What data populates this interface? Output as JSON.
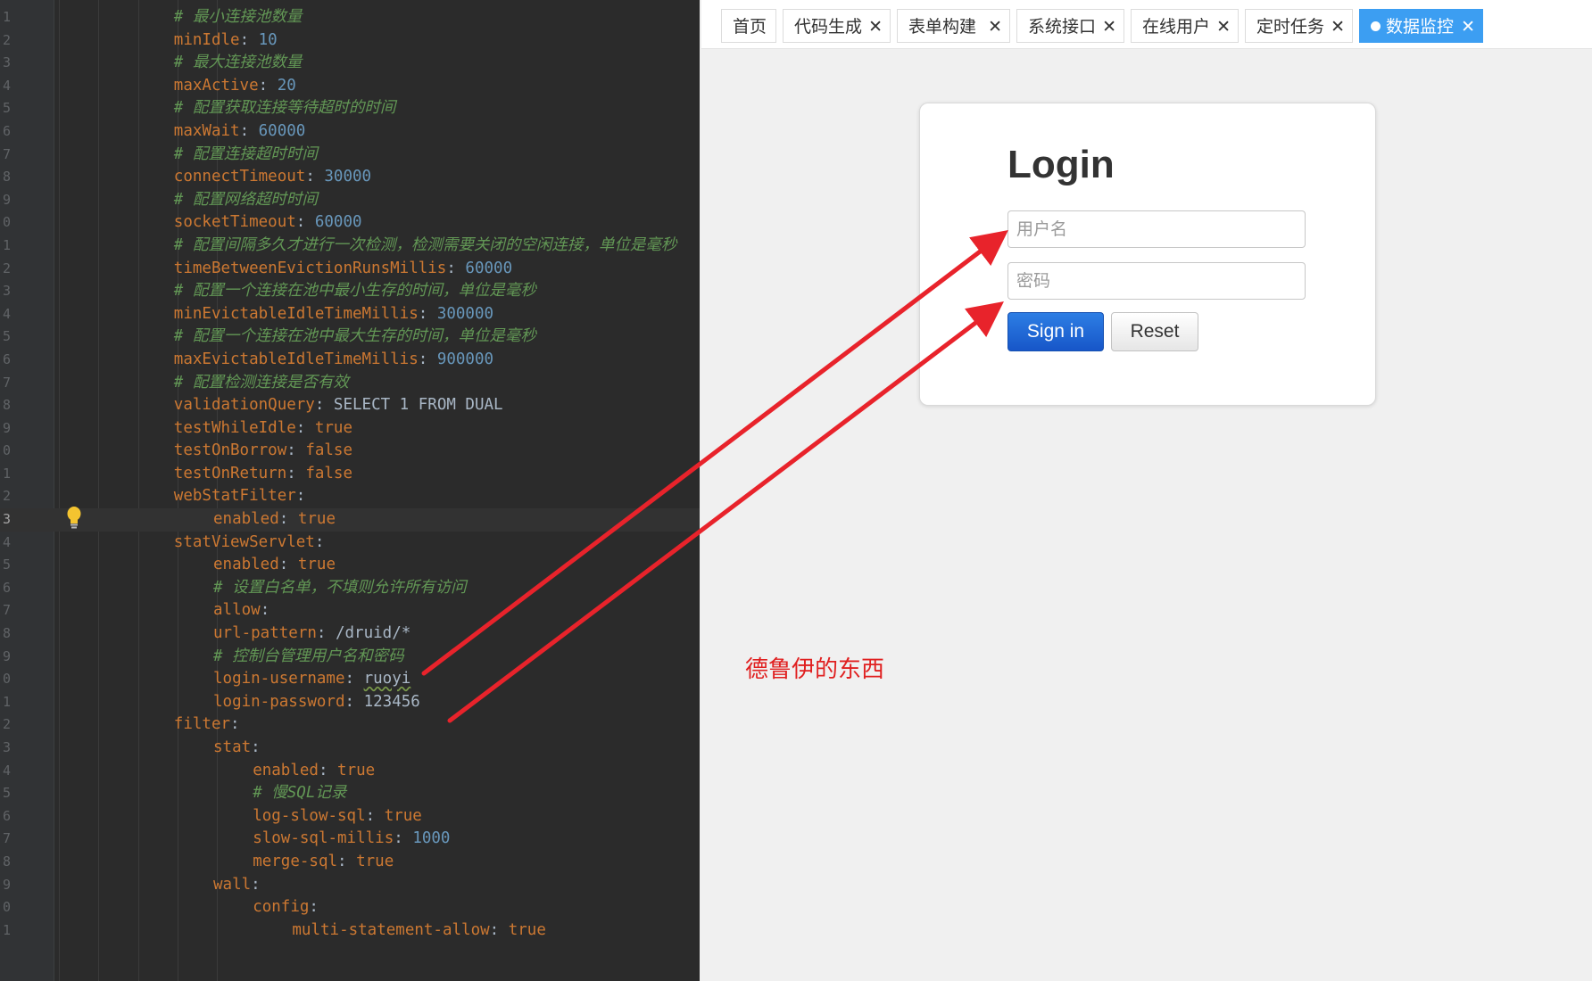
{
  "editor": {
    "lines": [
      {
        "num": "1",
        "indent": 4,
        "tokens": [
          {
            "t": "# 最小连接池数量",
            "c": "c"
          }
        ]
      },
      {
        "num": "2",
        "indent": 4,
        "tokens": [
          {
            "t": "minIdle",
            "c": "k"
          },
          {
            "t": ": ",
            "c": "p"
          },
          {
            "t": "10",
            "c": "n"
          }
        ]
      },
      {
        "num": "3",
        "indent": 4,
        "tokens": [
          {
            "t": "# 最大连接池数量",
            "c": "c"
          }
        ]
      },
      {
        "num": "4",
        "indent": 4,
        "tokens": [
          {
            "t": "maxActive",
            "c": "k"
          },
          {
            "t": ": ",
            "c": "p"
          },
          {
            "t": "20",
            "c": "n"
          }
        ]
      },
      {
        "num": "5",
        "indent": 4,
        "tokens": [
          {
            "t": "# 配置获取连接等待超时的时间",
            "c": "c"
          }
        ]
      },
      {
        "num": "6",
        "indent": 4,
        "tokens": [
          {
            "t": "maxWait",
            "c": "k"
          },
          {
            "t": ": ",
            "c": "p"
          },
          {
            "t": "60000",
            "c": "n"
          }
        ]
      },
      {
        "num": "7",
        "indent": 4,
        "tokens": [
          {
            "t": "# 配置连接超时时间",
            "c": "c"
          }
        ]
      },
      {
        "num": "8",
        "indent": 4,
        "tokens": [
          {
            "t": "connectTimeout",
            "c": "k"
          },
          {
            "t": ": ",
            "c": "p"
          },
          {
            "t": "30000",
            "c": "n"
          }
        ]
      },
      {
        "num": "9",
        "indent": 4,
        "tokens": [
          {
            "t": "# 配置网络超时时间",
            "c": "c"
          }
        ]
      },
      {
        "num": "0",
        "indent": 4,
        "tokens": [
          {
            "t": "socketTimeout",
            "c": "k"
          },
          {
            "t": ": ",
            "c": "p"
          },
          {
            "t": "60000",
            "c": "n"
          }
        ]
      },
      {
        "num": "1",
        "indent": 4,
        "tokens": [
          {
            "t": "# 配置间隔多久才进行一次检测，检测需要关闭的空闲连接，单位是毫秒",
            "c": "c"
          }
        ]
      },
      {
        "num": "2",
        "indent": 4,
        "tokens": [
          {
            "t": "timeBetweenEvictionRunsMillis",
            "c": "k"
          },
          {
            "t": ": ",
            "c": "p"
          },
          {
            "t": "60000",
            "c": "n"
          }
        ]
      },
      {
        "num": "3",
        "indent": 4,
        "tokens": [
          {
            "t": "# 配置一个连接在池中最小生存的时间，单位是毫秒",
            "c": "c"
          }
        ]
      },
      {
        "num": "4",
        "indent": 4,
        "tokens": [
          {
            "t": "minEvictableIdleTimeMillis",
            "c": "k"
          },
          {
            "t": ": ",
            "c": "p"
          },
          {
            "t": "300000",
            "c": "n"
          }
        ]
      },
      {
        "num": "5",
        "indent": 4,
        "tokens": [
          {
            "t": "# 配置一个连接在池中最大生存的时间，单位是毫秒",
            "c": "c"
          }
        ]
      },
      {
        "num": "6",
        "indent": 4,
        "tokens": [
          {
            "t": "maxEvictableIdleTimeMillis",
            "c": "k"
          },
          {
            "t": ": ",
            "c": "p"
          },
          {
            "t": "900000",
            "c": "n"
          }
        ]
      },
      {
        "num": "7",
        "indent": 4,
        "tokens": [
          {
            "t": "# 配置检测连接是否有效",
            "c": "c"
          }
        ]
      },
      {
        "num": "8",
        "indent": 4,
        "tokens": [
          {
            "t": "validationQuery",
            "c": "k"
          },
          {
            "t": ": ",
            "c": "p"
          },
          {
            "t": "SELECT 1 FROM DUAL",
            "c": "s"
          }
        ]
      },
      {
        "num": "9",
        "indent": 4,
        "tokens": [
          {
            "t": "testWhileIdle",
            "c": "k"
          },
          {
            "t": ": ",
            "c": "p"
          },
          {
            "t": "true",
            "c": "k"
          }
        ]
      },
      {
        "num": "0",
        "indent": 4,
        "tokens": [
          {
            "t": "testOnBorrow",
            "c": "k"
          },
          {
            "t": ": ",
            "c": "p"
          },
          {
            "t": "false",
            "c": "k"
          }
        ]
      },
      {
        "num": "1",
        "indent": 4,
        "tokens": [
          {
            "t": "testOnReturn",
            "c": "k"
          },
          {
            "t": ": ",
            "c": "p"
          },
          {
            "t": "false",
            "c": "k"
          }
        ]
      },
      {
        "num": "2",
        "indent": 4,
        "tokens": [
          {
            "t": "webStatFilter",
            "c": "k"
          },
          {
            "t": ":",
            "c": "p"
          }
        ]
      },
      {
        "num": "3",
        "indent": 5,
        "current": true,
        "tokens": [
          {
            "t": "enabled",
            "c": "k"
          },
          {
            "t": ": ",
            "c": "p"
          },
          {
            "t": "true",
            "c": "k"
          }
        ]
      },
      {
        "num": "4",
        "indent": 4,
        "tokens": [
          {
            "t": "statViewServlet",
            "c": "k"
          },
          {
            "t": ":",
            "c": "p"
          }
        ]
      },
      {
        "num": "5",
        "indent": 5,
        "tokens": [
          {
            "t": "enabled",
            "c": "k"
          },
          {
            "t": ": ",
            "c": "p"
          },
          {
            "t": "true",
            "c": "k"
          }
        ]
      },
      {
        "num": "6",
        "indent": 5,
        "tokens": [
          {
            "t": "# 设置白名单，不填则允许所有访问",
            "c": "c"
          }
        ]
      },
      {
        "num": "7",
        "indent": 5,
        "tokens": [
          {
            "t": "allow",
            "c": "k"
          },
          {
            "t": ":",
            "c": "p"
          }
        ]
      },
      {
        "num": "8",
        "indent": 5,
        "tokens": [
          {
            "t": "url-pattern",
            "c": "k"
          },
          {
            "t": ": ",
            "c": "p"
          },
          {
            "t": "/druid/*",
            "c": "s"
          }
        ]
      },
      {
        "num": "9",
        "indent": 5,
        "tokens": [
          {
            "t": "# 控制台管理用户名和密码",
            "c": "c"
          }
        ]
      },
      {
        "num": "0",
        "indent": 5,
        "tokens": [
          {
            "t": "login-username",
            "c": "k"
          },
          {
            "t": ": ",
            "c": "p"
          },
          {
            "t": "ruoyi",
            "c": "s",
            "squiggle": true
          }
        ]
      },
      {
        "num": "1",
        "indent": 5,
        "tokens": [
          {
            "t": "login-password",
            "c": "k"
          },
          {
            "t": ": ",
            "c": "p"
          },
          {
            "t": "123456",
            "c": "s"
          }
        ]
      },
      {
        "num": "2",
        "indent": 4,
        "tokens": [
          {
            "t": "filter",
            "c": "k"
          },
          {
            "t": ":",
            "c": "p"
          }
        ]
      },
      {
        "num": "3",
        "indent": 5,
        "tokens": [
          {
            "t": "stat",
            "c": "k"
          },
          {
            "t": ":",
            "c": "p"
          }
        ]
      },
      {
        "num": "4",
        "indent": 6,
        "tokens": [
          {
            "t": "enabled",
            "c": "k"
          },
          {
            "t": ": ",
            "c": "p"
          },
          {
            "t": "true",
            "c": "k"
          }
        ]
      },
      {
        "num": "5",
        "indent": 6,
        "tokens": [
          {
            "t": "# 慢SQL记录",
            "c": "c"
          }
        ]
      },
      {
        "num": "6",
        "indent": 6,
        "tokens": [
          {
            "t": "log-slow-sql",
            "c": "k"
          },
          {
            "t": ": ",
            "c": "p"
          },
          {
            "t": "true",
            "c": "k"
          }
        ]
      },
      {
        "num": "7",
        "indent": 6,
        "tokens": [
          {
            "t": "slow-sql-millis",
            "c": "k"
          },
          {
            "t": ": ",
            "c": "p"
          },
          {
            "t": "1000",
            "c": "n"
          }
        ]
      },
      {
        "num": "8",
        "indent": 6,
        "tokens": [
          {
            "t": "merge-sql",
            "c": "k"
          },
          {
            "t": ": ",
            "c": "p"
          },
          {
            "t": "true",
            "c": "k"
          }
        ]
      },
      {
        "num": "9",
        "indent": 5,
        "tokens": [
          {
            "t": "wall",
            "c": "k"
          },
          {
            "t": ":",
            "c": "p"
          }
        ]
      },
      {
        "num": "0",
        "indent": 6,
        "tokens": [
          {
            "t": "config",
            "c": "k"
          },
          {
            "t": ":",
            "c": "p"
          }
        ]
      },
      {
        "num": "1",
        "indent": 7,
        "tokens": [
          {
            "t": "multi-statement-allow",
            "c": "k"
          },
          {
            "t": ": ",
            "c": "p"
          },
          {
            "t": "true",
            "c": "k"
          }
        ]
      }
    ]
  },
  "tabs": [
    {
      "label": "首页",
      "active": false,
      "closable": false
    },
    {
      "label": "代码生成",
      "active": false,
      "closable": true
    },
    {
      "label": "表单构建",
      "active": false,
      "closable": true
    },
    {
      "label": "系统接口",
      "active": false,
      "closable": true
    },
    {
      "label": "在线用户",
      "active": false,
      "closable": true
    },
    {
      "label": "定时任务",
      "active": false,
      "closable": true
    },
    {
      "label": "数据监控",
      "active": true,
      "closable": true
    }
  ],
  "tab_close_glyph": "✕",
  "login": {
    "title": "Login",
    "username_placeholder": "用户名",
    "password_placeholder": "密码",
    "sign_in_label": "Sign in",
    "reset_label": "Reset"
  },
  "annotation": {
    "text": "德鲁伊的东西",
    "color": "#e02020"
  },
  "colors": {
    "editor_bg": "#2b2b2b",
    "keyword": "#cc7832",
    "number": "#6897bb",
    "comment": "#629755",
    "active_tab": "#3c9ef2",
    "primary_button": "#1756c8"
  }
}
